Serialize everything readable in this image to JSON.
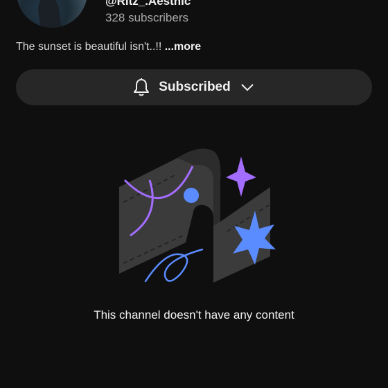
{
  "channel": {
    "handle": "@Ritz_.Aesthic",
    "subscribers": "328 subscribers",
    "description": "The sunset is beautiful isn't..!! ",
    "more_label": "...more"
  },
  "subscribe_button": {
    "label": "Subscribed",
    "bell_icon": "bell-icon",
    "chevron_icon": "chevron-down-icon"
  },
  "empty_state": {
    "message": "This channel doesn't have any content"
  },
  "colors": {
    "background": "#0f0f0f",
    "button_bg": "#272727",
    "accent_purple": "#a36dff",
    "accent_blue": "#5b8cff"
  }
}
